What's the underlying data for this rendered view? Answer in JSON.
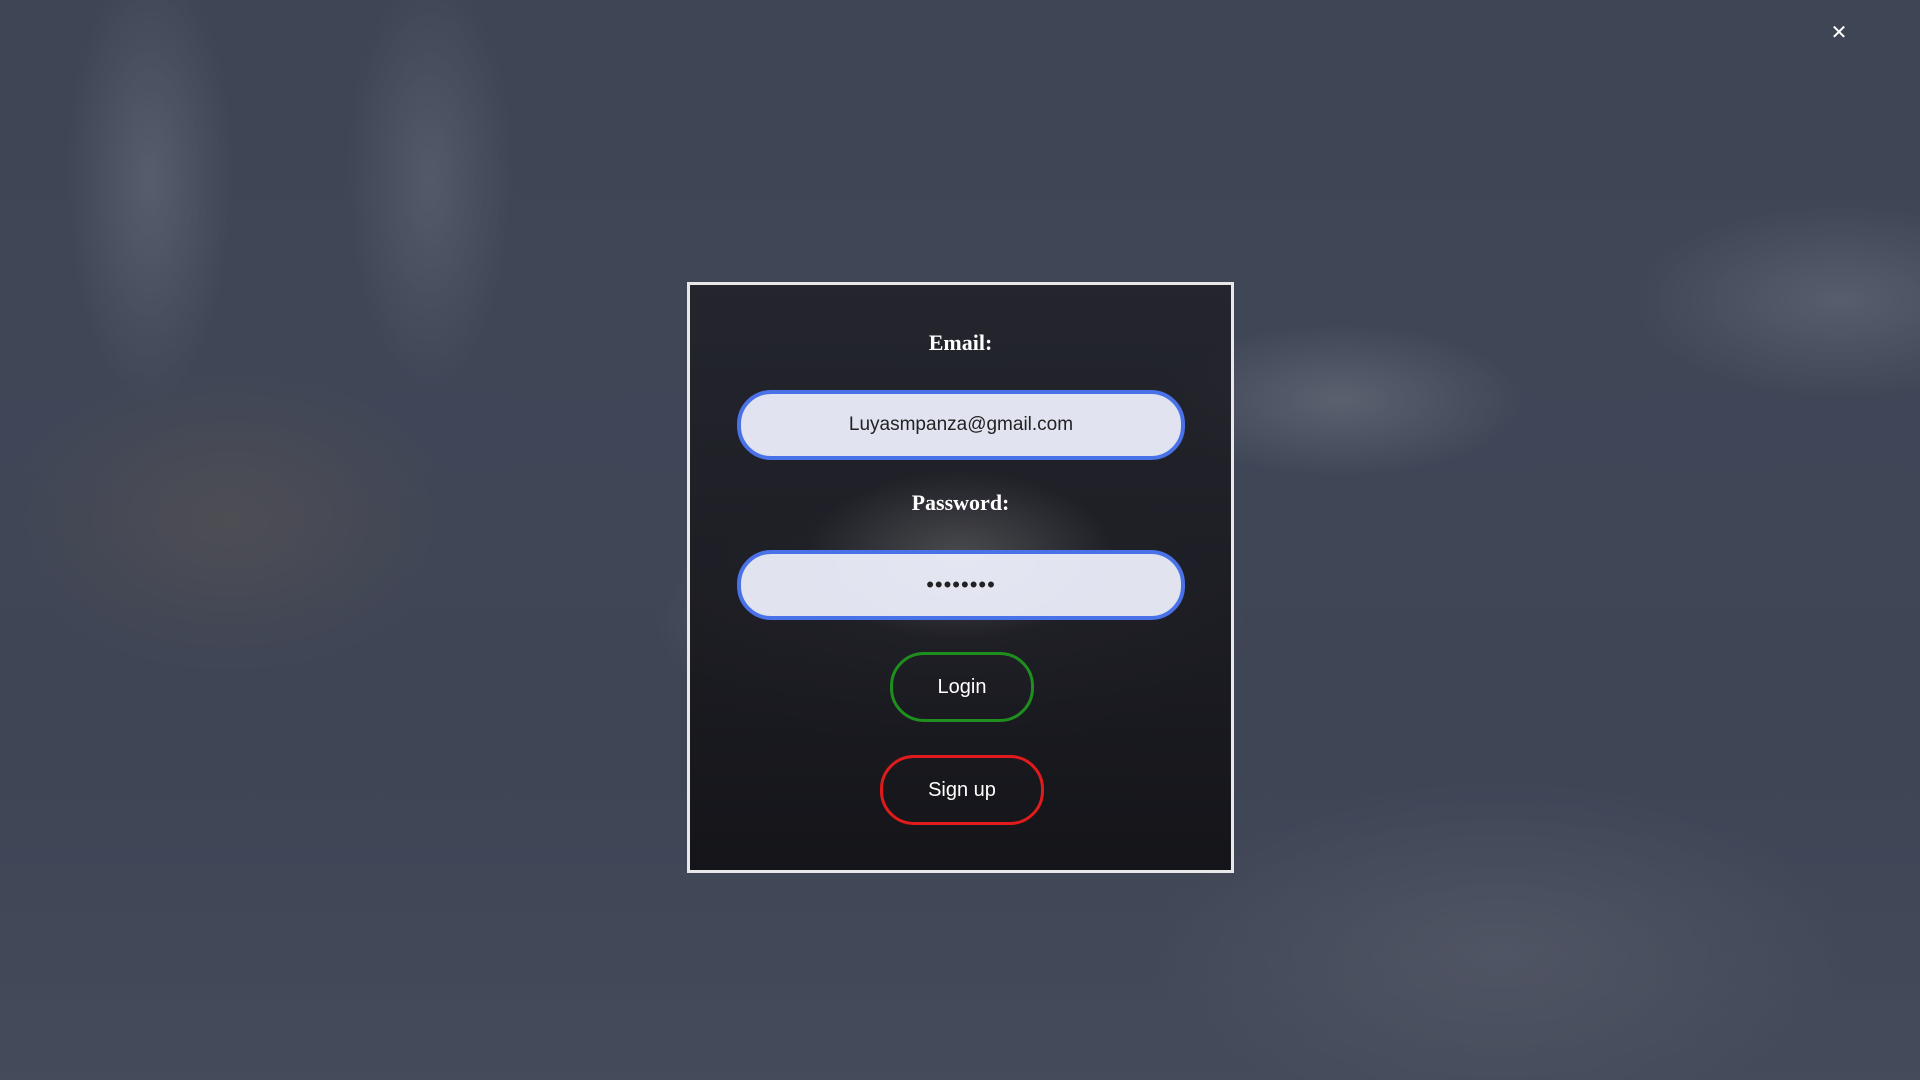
{
  "close": {
    "glyph": "✕"
  },
  "login_form": {
    "email_label": "Email:",
    "email_value": "Luyasmpanza@gmail.com",
    "password_label": "Password:",
    "password_value": "12345678",
    "login_label": "Login",
    "signup_label": "Sign up"
  },
  "colors": {
    "input_border": "#4a72e8",
    "login_border": "#1e8f1e",
    "signup_border": "#e01b1b"
  },
  "icons": {
    "close": "close-icon"
  }
}
